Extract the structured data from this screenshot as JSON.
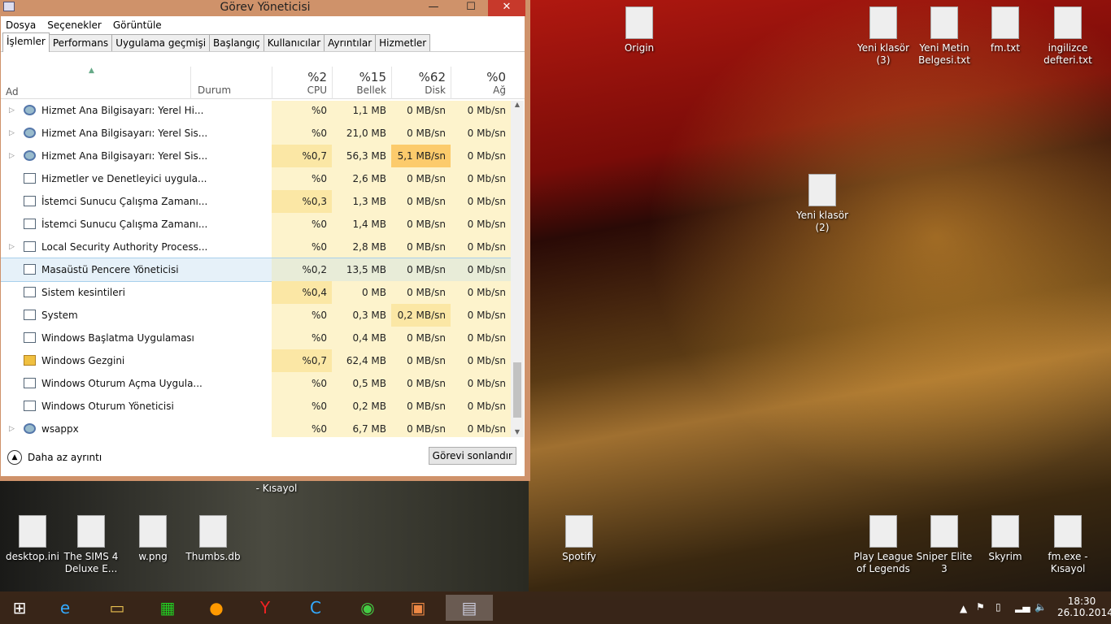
{
  "window": {
    "title": "Görev Yöneticisi",
    "minimize": "—",
    "maximize": "☐",
    "close": "✕"
  },
  "menu": [
    "Dosya",
    "Seçenekler",
    "Görüntüle"
  ],
  "tabs": [
    "İşlemler",
    "Performans",
    "Uygulama geçmişi",
    "Başlangıç",
    "Kullanıcılar",
    "Ayrıntılar",
    "Hizmetler"
  ],
  "columns": {
    "name": "Ad",
    "status": "Durum",
    "cpu": {
      "pct": "%2",
      "label": "CPU"
    },
    "mem": {
      "pct": "%15",
      "label": "Bellek"
    },
    "disk": {
      "pct": "%62",
      "label": "Disk"
    },
    "net": {
      "pct": "%0",
      "label": "Ağ"
    }
  },
  "rows": [
    {
      "name": "Hizmet Ana Bilgisayarı: Yerel Hi...",
      "cpu": "%0",
      "mem": "1,1 MB",
      "disk": "0 MB/sn",
      "net": "0 Mb/sn",
      "icon": "gear",
      "exp": true
    },
    {
      "name": "Hizmet Ana Bilgisayarı: Yerel Sis...",
      "cpu": "%0",
      "mem": "21,0 MB",
      "disk": "0 MB/sn",
      "net": "0 Mb/sn",
      "icon": "gear",
      "exp": true
    },
    {
      "name": "Hizmet Ana Bilgisayarı: Yerel Sis...",
      "cpu": "%0,7",
      "mem": "56,3 MB",
      "disk": "5,1 MB/sn",
      "net": "0 Mb/sn",
      "icon": "gear",
      "exp": true
    },
    {
      "name": "Hizmetler ve Denetleyici uygula...",
      "cpu": "%0",
      "mem": "2,6 MB",
      "disk": "0 MB/sn",
      "net": "0 Mb/sn",
      "icon": "app"
    },
    {
      "name": "İstemci Sunucu Çalışma Zamanı...",
      "cpu": "%0,3",
      "mem": "1,3 MB",
      "disk": "0 MB/sn",
      "net": "0 Mb/sn",
      "icon": "app"
    },
    {
      "name": "İstemci Sunucu Çalışma Zamanı...",
      "cpu": "%0",
      "mem": "1,4 MB",
      "disk": "0 MB/sn",
      "net": "0 Mb/sn",
      "icon": "app"
    },
    {
      "name": "Local Security Authority Process...",
      "cpu": "%0",
      "mem": "2,8 MB",
      "disk": "0 MB/sn",
      "net": "0 Mb/sn",
      "icon": "app",
      "exp": true
    },
    {
      "name": "Masaüstü Pencere Yöneticisi",
      "cpu": "%0,2",
      "mem": "13,5 MB",
      "disk": "0 MB/sn",
      "net": "0 Mb/sn",
      "icon": "app",
      "selected": true
    },
    {
      "name": "Sistem kesintileri",
      "cpu": "%0,4",
      "mem": "0 MB",
      "disk": "0 MB/sn",
      "net": "0 Mb/sn",
      "icon": "app"
    },
    {
      "name": "System",
      "cpu": "%0",
      "mem": "0,3 MB",
      "disk": "0,2 MB/sn",
      "net": "0 Mb/sn",
      "icon": "app"
    },
    {
      "name": "Windows Başlatma Uygulaması",
      "cpu": "%0",
      "mem": "0,4 MB",
      "disk": "0 MB/sn",
      "net": "0 Mb/sn",
      "icon": "app"
    },
    {
      "name": "Windows Gezgini",
      "cpu": "%0,7",
      "mem": "62,4 MB",
      "disk": "0 MB/sn",
      "net": "0 Mb/sn",
      "icon": "folder"
    },
    {
      "name": "Windows Oturum Açma Uygula...",
      "cpu": "%0",
      "mem": "0,5 MB",
      "disk": "0 MB/sn",
      "net": "0 Mb/sn",
      "icon": "app"
    },
    {
      "name": "Windows Oturum Yöneticisi",
      "cpu": "%0",
      "mem": "0,2 MB",
      "disk": "0 MB/sn",
      "net": "0 Mb/sn",
      "icon": "app"
    },
    {
      "name": "wsappx",
      "cpu": "%0",
      "mem": "6,7 MB",
      "disk": "0 MB/sn",
      "net": "0 Mb/sn",
      "icon": "gear",
      "exp": true
    }
  ],
  "footer": {
    "less_details": "Daha az ayrıntı",
    "end_task": "Görevi sonlandır"
  },
  "desktop": [
    {
      "label": "Origin"
    },
    {
      "label": "Yeni klasör\n(3)"
    },
    {
      "label": "Yeni Metin\nBelgesi.txt"
    },
    {
      "label": "fm.txt"
    },
    {
      "label": "ingilizce\ndefteri.txt"
    },
    {
      "label": "Yeni klasör\n(2)"
    },
    {
      "label": "desktop.ini"
    },
    {
      "label": "The SIMS 4\nDeluxe E..."
    },
    {
      "label": "w.png"
    },
    {
      "label": "Thumbs.db"
    },
    {
      "label": "Spotify"
    },
    {
      "label": "Play League\nof Legends"
    },
    {
      "label": "Sniper Elite 3"
    },
    {
      "label": "Skyrim"
    },
    {
      "label": "fm.exe -\nKısayol"
    },
    {
      "label": "- Kısayol"
    }
  ],
  "tray": {
    "time": "18:30",
    "date": "26.10.2014"
  }
}
